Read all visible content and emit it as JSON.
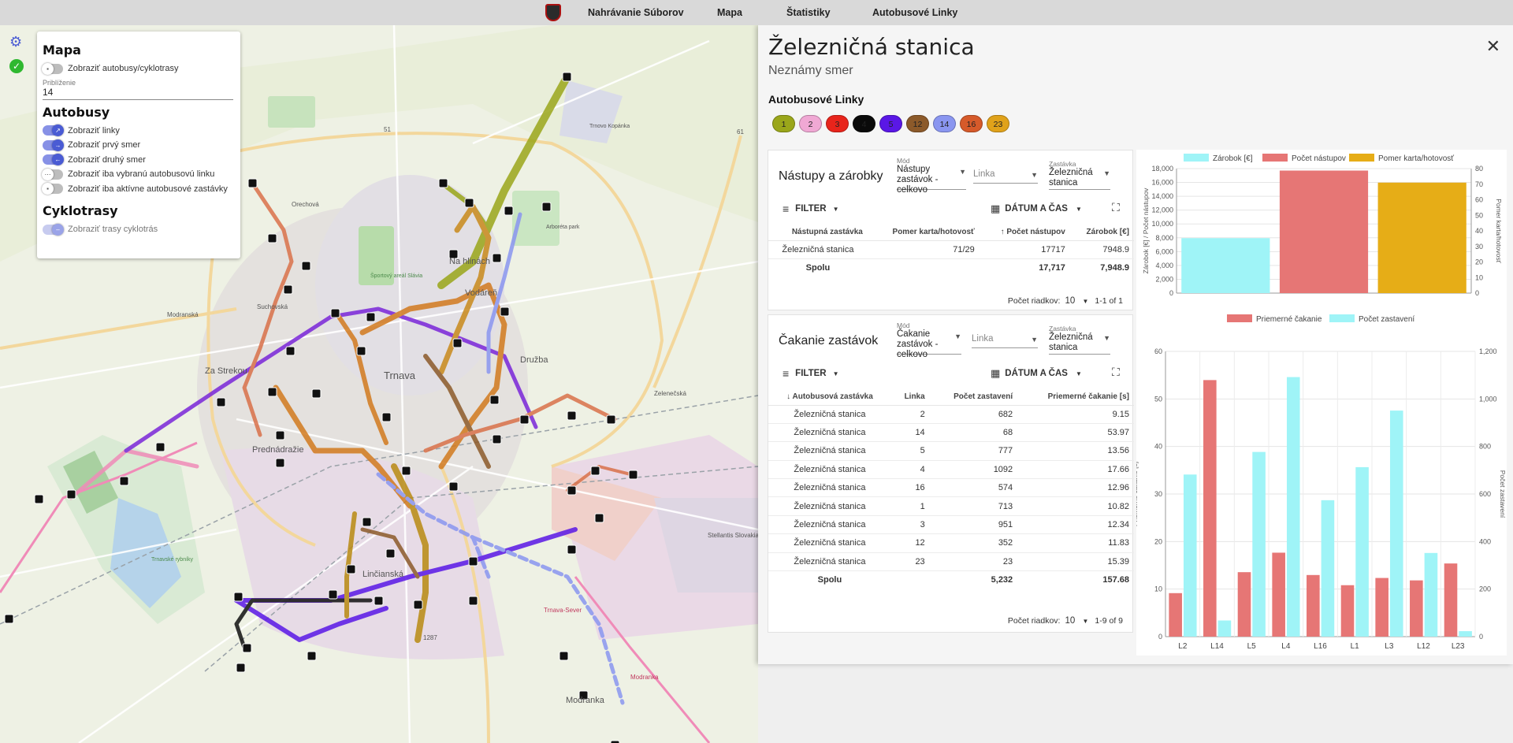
{
  "topnav": {
    "links": [
      "Nahrávanie Súborov",
      "Mapa",
      "Štatistiky",
      "Autobusové Linky"
    ]
  },
  "map_panel": {
    "mapa_title": "Mapa",
    "show_buses_cycles": "Zobraziť autobusy/cyklotrasy",
    "zoom_label": "Priblíženie",
    "zoom_value": "14",
    "autobusy_title": "Autobusy",
    "bus_toggles": [
      "Zobraziť linky",
      "Zobraziť prvý smer",
      "Zobraziť druhý smer",
      "Zobraziť iba vybranú autobusovú linku",
      "Zobraziť iba aktívne autobusové zastávky"
    ],
    "cyklotrasy_title": "Cyklotrasy",
    "cycle_toggle": "Zobraziť trasy cyklotrás"
  },
  "map_labels": {
    "trnava": "Trnava",
    "na_hlinach": "Na hlinách",
    "vodaren": "Vodáreň",
    "druzba": "Družba",
    "za_strekou": "Za Strekou",
    "prednadrazie": "Prednádražie",
    "linciana": "Linčianská",
    "modranka": "Modranka",
    "modranska": "Modranská",
    "trnovo_kopanka": "Trnovo Kopánka",
    "stellantis": "Stellantis Slovakia",
    "trnavske_rybniky": "Trnavské rybníky",
    "arboreta": "Arboréta park",
    "sportovy": "Športový areál Slávia",
    "road_51": "51",
    "road_61": "61",
    "road_1287": "1287",
    "modrankaveln": "Modranka",
    "zelenecska": "Zelenečská",
    "suchovska": "Suchovská",
    "orezova": "Orechová",
    "sever": "Trnava-Sever"
  },
  "detail": {
    "title": "Železničná stanica",
    "subtitle": "Neznámy smer",
    "lines_heading": "Autobusové Linky",
    "chips": [
      {
        "label": "1",
        "color": "#9aa61a"
      },
      {
        "label": "2",
        "color": "#f0a8d4"
      },
      {
        "label": "3",
        "color": "#e8241b"
      },
      {
        "label": "4",
        "color": "#0a0a0a"
      },
      {
        "label": "5",
        "color": "#5a17e6"
      },
      {
        "label": "12",
        "color": "#8c5a2a"
      },
      {
        "label": "14",
        "color": "#8a96f0"
      },
      {
        "label": "16",
        "color": "#d65a2a"
      },
      {
        "label": "23",
        "color": "#e0a21a"
      }
    ]
  },
  "boarding": {
    "title": "Nástupy a zárobky",
    "mode_label": "Mód",
    "mode_value": "Nástupy zastávok - celkovo",
    "line_placeholder": "Linka",
    "stop_label": "Zastávka",
    "stop_value": "Železničná stanica",
    "filter": "FILTER",
    "datetime": "DÁTUM A ČAS",
    "headers": [
      "Nástupná zastávka",
      "Pomer karta/hotovosť",
      "Počet nástupov",
      "Zárobok [€]"
    ],
    "rows": [
      [
        "Železničná stanica",
        "71/29",
        "17717",
        "7948.9"
      ]
    ],
    "total": [
      "Spolu",
      "",
      "17,717",
      "7,948.9"
    ],
    "rows_label": "Počet riadkov:",
    "rows_value": "10",
    "range": "1-1 of 1"
  },
  "waiting": {
    "title": "Čakanie zastávok",
    "mode_label": "Mód",
    "mode_value": "Čakanie zastávok - celkovo",
    "line_placeholder": "Linka",
    "stop_label": "Zastávka",
    "stop_value": "Železničná stanica",
    "filter": "FILTER",
    "datetime": "DÁTUM A ČAS",
    "headers": [
      "Autobusová zastávka",
      "Linka",
      "Počet zastavení",
      "Priemerné čakanie [s]"
    ],
    "rows": [
      [
        "Železničná stanica",
        "2",
        "682",
        "9.15"
      ],
      [
        "Železničná stanica",
        "14",
        "68",
        "53.97"
      ],
      [
        "Železničná stanica",
        "5",
        "777",
        "13.56"
      ],
      [
        "Železničná stanica",
        "4",
        "1092",
        "17.66"
      ],
      [
        "Železničná stanica",
        "16",
        "574",
        "12.96"
      ],
      [
        "Železničná stanica",
        "1",
        "713",
        "10.82"
      ],
      [
        "Železničná stanica",
        "3",
        "951",
        "12.34"
      ],
      [
        "Železničná stanica",
        "12",
        "352",
        "11.83"
      ],
      [
        "Železničná stanica",
        "23",
        "23",
        "15.39"
      ]
    ],
    "total": [
      "Spolu",
      "",
      "5,232",
      "157.68"
    ],
    "rows_label": "Počet riadkov:",
    "rows_value": "10",
    "range": "1-9 of 9"
  },
  "colors": {
    "accent": "#4a5bd4",
    "cyan": "#9ff4f7",
    "red": "#e67675",
    "gold": "#e6ad17"
  },
  "chart_data": [
    {
      "type": "bar",
      "categories": [
        "Zárobok [€]",
        "Počet nástupov",
        "Pomer karta/hotovosť"
      ],
      "series": [
        {
          "name": "Zárobok [€]",
          "values": [
            7948.9
          ],
          "axis": "left",
          "color": "#9ff4f7"
        },
        {
          "name": "Počet nástupov",
          "values": [
            17717
          ],
          "axis": "left",
          "color": "#e67675"
        },
        {
          "name": "Pomer karta/hotovosť",
          "values": [
            71
          ],
          "axis": "right",
          "color": "#e6ad17"
        }
      ],
      "ylabel": "Zárobok [€] / Počet nástupov",
      "y2label": "Pomer karta/hotovosť",
      "ylim": [
        0,
        18000
      ],
      "y2lim": [
        0,
        80
      ],
      "yticks": [
        "0",
        "2,000",
        "4,000",
        "6,000",
        "8,000",
        "10,000",
        "12,000",
        "14,000",
        "16,000",
        "18,000"
      ],
      "y2ticks": [
        "0",
        "10",
        "20",
        "30",
        "40",
        "50",
        "60",
        "70",
        "80"
      ],
      "legend": "top"
    },
    {
      "type": "bar",
      "categories": [
        "L2",
        "L14",
        "L5",
        "L4",
        "L16",
        "L1",
        "L3",
        "L12",
        "L23"
      ],
      "series": [
        {
          "name": "Priemerné čakanie",
          "values": [
            9.15,
            53.97,
            13.56,
            17.66,
            12.96,
            10.82,
            12.34,
            11.83,
            15.39
          ],
          "axis": "left",
          "color": "#e67675"
        },
        {
          "name": "Počet zastavení",
          "values": [
            682,
            68,
            777,
            1092,
            574,
            713,
            951,
            352,
            23
          ],
          "axis": "right",
          "color": "#9ff4f7"
        }
      ],
      "ylabel": "Priemerné čakanie [s]",
      "y2label": "Počet zastavení",
      "ylim": [
        0,
        60
      ],
      "y2lim": [
        0,
        1200
      ],
      "yticks": [
        "0",
        "10",
        "20",
        "30",
        "40",
        "50",
        "60"
      ],
      "y2ticks": [
        "0",
        "200",
        "400",
        "600",
        "800",
        "1,000",
        "1,200"
      ],
      "legend": "top"
    }
  ]
}
